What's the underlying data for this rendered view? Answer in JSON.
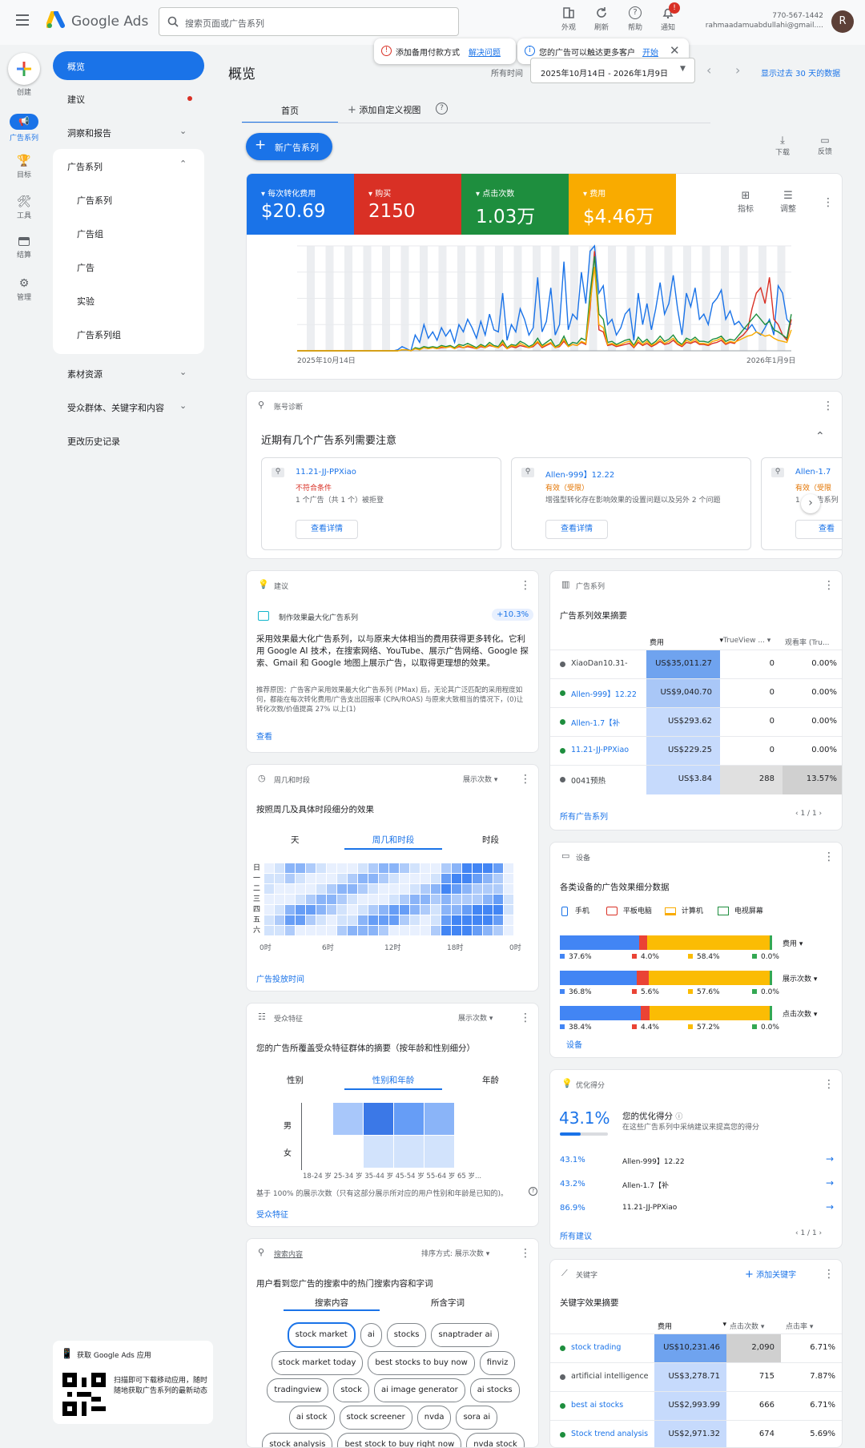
{
  "app": {
    "name": "Google Ads",
    "search_placeholder": "搜索页面或广告系列"
  },
  "top_actions": {
    "appearance": "外观",
    "refresh": "刷新",
    "help": "帮助",
    "notifications": "通知",
    "notif_count": "!",
    "account_id": "770-567-1442",
    "account_email": "rahmaadamuabdullahi@gmail....",
    "avatar": "R"
  },
  "alerts": {
    "payment_text": "添加备用付款方式",
    "payment_link": "解决问题",
    "reach_text": "您的广告可以触达更多客户",
    "reach_link": "开始"
  },
  "rail": {
    "create": "创建",
    "campaigns": "广告系列",
    "goals": "目标",
    "tools": "工具",
    "billing": "结算",
    "admin": "管理"
  },
  "nav": {
    "overview": "概览",
    "recommendations": "建议",
    "insights": "洞察和报告",
    "campaigns_group": "广告系列",
    "sub": [
      "广告系列",
      "广告组",
      "广告",
      "实验",
      "广告系列组"
    ],
    "assets": "素材资源",
    "audiences": "受众群体、关键字和内容",
    "history": "更改历史记录"
  },
  "app_promo": {
    "title": "获取 Google Ads 应用",
    "text": "扫描即可下载移动应用，随时随地获取广告系列的最新动态"
  },
  "page": {
    "title": "概览",
    "date_label": "所有时间",
    "date_range": "2025年10月14日 - 2026年1月9日",
    "last30": "显示过去 30 天的数据"
  },
  "tabs": {
    "home": "首页",
    "add_view": "添加自定义视图",
    "help": "?"
  },
  "new_campaign": "新广告系列",
  "toolbar": {
    "download": "下载",
    "feedback": "反馈"
  },
  "metrics": [
    {
      "label": "每次转化费用",
      "value": "$20.69",
      "color": "#1a73e8"
    },
    {
      "label": "购买",
      "value": "2150",
      "color": "#d93025"
    },
    {
      "label": "点击次数",
      "value": "1.03万",
      "color": "#1e8e3e"
    },
    {
      "label": "费用",
      "value": "$4.46万",
      "color": "#f9ab00"
    }
  ],
  "chart_actions": {
    "metrics": "指标",
    "adjust": "调整"
  },
  "chart_data": {
    "type": "line",
    "x_start": "2025年10月14日",
    "x_end": "2026年1月9日",
    "ylim": [
      0,
      100
    ],
    "series": [
      {
        "color": "#1a73e8",
        "values": [
          0,
          0,
          0,
          0,
          0,
          0,
          0,
          0,
          0,
          0,
          0,
          0,
          0,
          0,
          0,
          0,
          0,
          0,
          0,
          0,
          0,
          0,
          0,
          1,
          4,
          2,
          0,
          15,
          8,
          25,
          12,
          18,
          10,
          22,
          14,
          20,
          8,
          25,
          18,
          30,
          22,
          12,
          28,
          15,
          35,
          20,
          18,
          55,
          10,
          25,
          18,
          40,
          30,
          15,
          22,
          70,
          18,
          28,
          60,
          15,
          25,
          85,
          20,
          35,
          30,
          75,
          45,
          95,
          100,
          55,
          62,
          25,
          30,
          15,
          22,
          35,
          40,
          10,
          55,
          25,
          45,
          20,
          40,
          65,
          35,
          45,
          72,
          40,
          15,
          55,
          42,
          60,
          30,
          35,
          25,
          45,
          50,
          58,
          30,
          38,
          25,
          28,
          22,
          20,
          25,
          18,
          15,
          22,
          30,
          15,
          62,
          55,
          30,
          25
        ]
      },
      {
        "color": "#d93025",
        "values": [
          0,
          0,
          0,
          0,
          0,
          0,
          0,
          0,
          0,
          0,
          0,
          0,
          0,
          0,
          0,
          0,
          0,
          0,
          0,
          0,
          0,
          0,
          0,
          0,
          1,
          1,
          0,
          2,
          2,
          3,
          2,
          3,
          2,
          3,
          3,
          4,
          2,
          4,
          3,
          4,
          3,
          2,
          4,
          3,
          5,
          4,
          3,
          6,
          2,
          4,
          3,
          5,
          4,
          3,
          4,
          8,
          3,
          5,
          7,
          3,
          4,
          9,
          4,
          6,
          5,
          8,
          6,
          40,
          95,
          20,
          18,
          5,
          6,
          4,
          5,
          6,
          7,
          3,
          8,
          5,
          7,
          4,
          6,
          9,
          6,
          7,
          10,
          6,
          4,
          8,
          7,
          9,
          6,
          6,
          5,
          7,
          8,
          10,
          6,
          8,
          7,
          12,
          15,
          20,
          40,
          55,
          60,
          45,
          70,
          30,
          25,
          15,
          10,
          30
        ]
      },
      {
        "color": "#1e8e3e",
        "values": [
          0,
          0,
          0,
          0,
          0,
          0,
          0,
          0,
          0,
          0,
          0,
          0,
          0,
          0,
          0,
          0,
          0,
          0,
          0,
          0,
          0,
          0,
          0,
          0,
          1,
          1,
          0,
          3,
          2,
          4,
          3,
          4,
          3,
          5,
          4,
          5,
          3,
          6,
          5,
          7,
          5,
          3,
          6,
          4,
          8,
          5,
          4,
          10,
          3,
          6,
          5,
          9,
          7,
          4,
          6,
          12,
          5,
          8,
          11,
          4,
          6,
          14,
          5,
          8,
          7,
          12,
          10,
          55,
          90,
          35,
          30,
          8,
          9,
          6,
          8,
          10,
          11,
          5,
          13,
          8,
          11,
          6,
          9,
          14,
          9,
          11,
          15,
          9,
          6,
          12,
          10,
          13,
          9,
          9,
          8,
          11,
          12,
          14,
          9,
          11,
          10,
          15,
          20,
          25,
          30,
          35,
          30,
          25,
          28,
          20,
          18,
          15,
          12,
          35
        ]
      },
      {
        "color": "#f9ab00",
        "values": [
          0,
          0,
          0,
          0,
          0,
          0,
          0,
          0,
          0,
          0,
          0,
          0,
          0,
          0,
          0,
          0,
          0,
          0,
          0,
          0,
          0,
          0,
          0,
          0,
          1,
          1,
          0,
          2,
          1,
          3,
          2,
          3,
          2,
          4,
          3,
          4,
          2,
          5,
          3,
          5,
          4,
          2,
          5,
          3,
          6,
          4,
          3,
          8,
          2,
          5,
          4,
          7,
          5,
          3,
          5,
          9,
          4,
          6,
          8,
          3,
          5,
          11,
          4,
          6,
          5,
          9,
          7,
          45,
          80,
          25,
          22,
          6,
          7,
          5,
          6,
          8,
          9,
          4,
          10,
          6,
          9,
          5,
          7,
          11,
          7,
          9,
          12,
          7,
          5,
          10,
          8,
          11,
          7,
          7,
          6,
          9,
          10,
          12,
          7,
          9,
          8,
          10,
          12,
          14,
          15,
          18,
          16,
          14,
          15,
          12,
          10,
          9,
          8,
          20
        ]
      }
    ]
  },
  "diagnostics": {
    "header": "账号诊断",
    "title": "近期有几个广告系列需要注意",
    "cards": [
      {
        "name": "11.21-JJ-PPXiao",
        "status": "不符合条件",
        "status_color": "#d93025",
        "desc": "1 个广告（共 1 个）被拒登",
        "btn": "查看详情"
      },
      {
        "name": "Allen-999】12.22",
        "status": "有效（受限）",
        "status_color": "#e37400",
        "desc": "增强型转化存在影响效果的设置问题以及另外 2 个问题",
        "btn": "查看详情"
      },
      {
        "name": "Allen-1.7",
        "status": "有效（受限",
        "status_color": "#e37400",
        "desc": "1 个广告系列",
        "btn": "查看"
      }
    ]
  },
  "recommend": {
    "header": "建议",
    "item": "制作效果最大化广告系列",
    "badge": "+10.3%",
    "body": "采用效果最大化广告系列，以与原来大体相当的费用获得更多转化。它利用 Google AI 技术，在搜索网络、YouTube、展示广告网络、Google 探索、Gmail 和 Google 地图上展示广告，以取得更理想的效果。",
    "reason": "推荐原因：广告客户采用效果最大化广告系列 (PMax) 后，无论其广泛匹配的采用程度如何，都能在每次转化费用/广告支出回报率 (CPA/ROAS) 与原来大致相当的情况下，(0)让转化次数/价值提高 27% 以上(1)",
    "link": "查看"
  },
  "campaigns_card": {
    "header": "广告系列",
    "title": "广告系列效果摘要",
    "cols": [
      "费用",
      "TrueView ...",
      "观看率 (Tru..."
    ],
    "rows": [
      {
        "name": "XiaoDan10.31-",
        "dot": "#5f6368",
        "cost": "US$35,011.27",
        "tv": "0",
        "rate": "0.00%"
      },
      {
        "name": "Allen-999】12.22",
        "dot": "#1e8e3e",
        "cost": "US$9,040.70",
        "tv": "0",
        "rate": "0.00%"
      },
      {
        "name": "Allen-1.7【补",
        "dot": "#1e8e3e",
        "cost": "US$293.62",
        "tv": "0",
        "rate": "0.00%"
      },
      {
        "name": "11.21-JJ-PPXiao",
        "dot": "#1e8e3e",
        "cost": "US$229.25",
        "tv": "0",
        "rate": "0.00%"
      },
      {
        "name": "0041预热",
        "dot": "#5f6368",
        "cost": "US$3.84",
        "tv": "288",
        "rate": "13.57%"
      }
    ],
    "all": "所有广告系列",
    "pager": "1 / 1"
  },
  "daytime": {
    "header": "周几和时段",
    "sort": "展示次数",
    "title": "按照周几及具体时段细分的效果",
    "tabs": [
      "天",
      "周几和时段",
      "时段"
    ],
    "days": [
      "日",
      "一",
      "二",
      "三",
      "四",
      "五",
      "六"
    ],
    "hours": [
      "0时",
      "6时",
      "12时",
      "18时",
      "0时"
    ],
    "link": "广告投放时间"
  },
  "devices": {
    "header": "设备",
    "title": "各类设备的广告效果细分数据",
    "legend": [
      "手机",
      "平板电脑",
      "计算机",
      "电视屏幕"
    ],
    "rows": [
      {
        "metric": "费用",
        "values": [
          37.6,
          4.0,
          58.4,
          0.0
        ],
        "labels": [
          "37.6%",
          "4.0%",
          "58.4%",
          "0.0%"
        ]
      },
      {
        "metric": "展示次数",
        "values": [
          36.8,
          5.6,
          57.6,
          0.0
        ],
        "labels": [
          "36.8%",
          "5.6%",
          "57.6%",
          "0.0%"
        ]
      },
      {
        "metric": "点击次数",
        "values": [
          38.4,
          4.4,
          57.2,
          0.0
        ],
        "labels": [
          "38.4%",
          "4.4%",
          "57.2%",
          "0.0%"
        ]
      }
    ],
    "link": "设备"
  },
  "audience": {
    "header": "受众特征",
    "sort": "展示次数",
    "title": "您的广告所覆盖受众特征群体的摘要（按年龄和性别细分）",
    "tabs": [
      "性别",
      "性别和年龄",
      "年龄"
    ],
    "genders": [
      "男",
      "女"
    ],
    "ages": "18-24 岁 25-34 岁 35-44 岁 45-54 岁 55-64 岁 65 岁...",
    "note": "基于 100% 的展示次数（只有这部分展示所对应的用户性别和年龄是已知的)。",
    "link": "受众特征"
  },
  "optscore": {
    "header": "优化得分",
    "score": "43.1%",
    "score_value": 0.431,
    "label": "您的优化得分",
    "desc": "在这些广告系列中采纳建议来提高您的得分",
    "rows": [
      {
        "pct": "43.1%",
        "name": "Allen-999】12.22"
      },
      {
        "pct": "43.2%",
        "name": "Allen-1.7【补"
      },
      {
        "pct": "86.9%",
        "name": "11.21-JJ-PPXiao"
      }
    ],
    "link": "所有建议",
    "pager": "1 / 1"
  },
  "searchterms": {
    "header": "搜索内容",
    "sort_label": "排序方式:",
    "sort": "展示次数",
    "title": "用户看到您广告的搜索中的热门搜索内容和字词",
    "tabs": [
      "搜索内容",
      "所含字词"
    ],
    "chips": [
      "stock market",
      "ai",
      "stocks",
      "snaptrader ai",
      "stock market today",
      "best stocks to buy now",
      "finviz",
      "tradingview",
      "stock",
      "ai image generator",
      "ai stocks",
      "ai stock",
      "stock screener",
      "nvda",
      "sora ai",
      "stock analysis",
      "best stock to buy right now",
      "nvda stock"
    ]
  },
  "keywords": {
    "header": "关键字",
    "add": "添加关键字",
    "title": "关键字效果摘要",
    "cols": [
      "费用",
      "点击次数",
      "点击率"
    ],
    "rows": [
      {
        "name": "stock trading",
        "dot": "#1e8e3e",
        "cost": "US$10,231.46",
        "clicks": "2,090",
        "ctr": "6.71%"
      },
      {
        "name": "artificial intelligence",
        "dot": "#5f6368",
        "cost": "US$3,278.71",
        "clicks": "715",
        "ctr": "7.87%"
      },
      {
        "name": "best ai stocks",
        "dot": "#1e8e3e",
        "cost": "US$2,993.99",
        "clicks": "666",
        "ctr": "6.71%"
      },
      {
        "name": "Stock trend analysis",
        "dot": "#1e8e3e",
        "cost": "US$2,971.32",
        "clicks": "674",
        "ctr": "5.69%"
      }
    ]
  }
}
